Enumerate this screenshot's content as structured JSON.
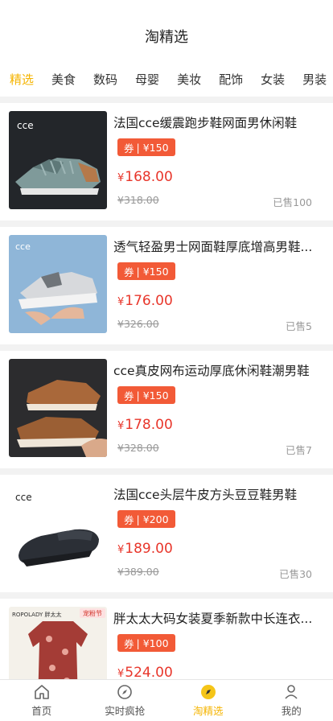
{
  "header": {
    "title": "淘精选"
  },
  "tabs": [
    {
      "label": "精选",
      "active": true
    },
    {
      "label": "美食"
    },
    {
      "label": "数码"
    },
    {
      "label": "母婴"
    },
    {
      "label": "美妆"
    },
    {
      "label": "配饰"
    },
    {
      "label": "女装"
    },
    {
      "label": "男装"
    }
  ],
  "products": [
    {
      "name": "法国cce缓震跑步鞋网面男休闲鞋",
      "coupon_prefix": "券",
      "coupon": "¥150",
      "price_symbol": "¥",
      "price": "168.00",
      "original_price": "¥318.00",
      "sold": "已售100",
      "image_logo": "cce",
      "image_icon": "grey-running-sneaker"
    },
    {
      "name": "透气轻盈男士网面鞋厚底增高男鞋...",
      "coupon_prefix": "券",
      "coupon": "¥150",
      "price_symbol": "¥",
      "price": "176.00",
      "original_price": "¥326.00",
      "sold": "已售5",
      "image_logo": "cce",
      "image_icon": "hand-holding-sneaker"
    },
    {
      "name": "cce真皮网布运动厚底休闲鞋潮男鞋",
      "coupon_prefix": "券",
      "coupon": "¥150",
      "price_symbol": "¥",
      "price": "178.00",
      "original_price": "¥328.00",
      "sold": "已售7",
      "image_logo": "",
      "image_icon": "brown-leather-shoe"
    },
    {
      "name": "法国cce头层牛皮方头豆豆鞋男鞋",
      "coupon_prefix": "券",
      "coupon": "¥200",
      "price_symbol": "¥",
      "price": "189.00",
      "original_price": "¥389.00",
      "sold": "已售30",
      "image_logo": "cce",
      "image_icon": "black-loafer"
    },
    {
      "name": "胖太太大码女装夏季新款中长连衣...",
      "coupon_prefix": "券",
      "coupon": "¥100",
      "price_symbol": "¥",
      "price": "524.00",
      "original_price": "",
      "sold": "",
      "image_logo": "ROPOLADY 胖太太",
      "image_badge": "宠粉节",
      "image_icon": "floral-dress"
    }
  ],
  "bottom_nav": [
    {
      "label": "首页",
      "icon": "home-icon"
    },
    {
      "label": "实时疯抢",
      "icon": "compass-icon"
    },
    {
      "label": "淘精选",
      "icon": "tag-icon",
      "active": true
    },
    {
      "label": "我的",
      "icon": "user-icon"
    }
  ],
  "colors": {
    "accent": "#f5b400",
    "coupon_bg": "#f25a37",
    "price": "#e8362b",
    "muted": "#999999"
  }
}
